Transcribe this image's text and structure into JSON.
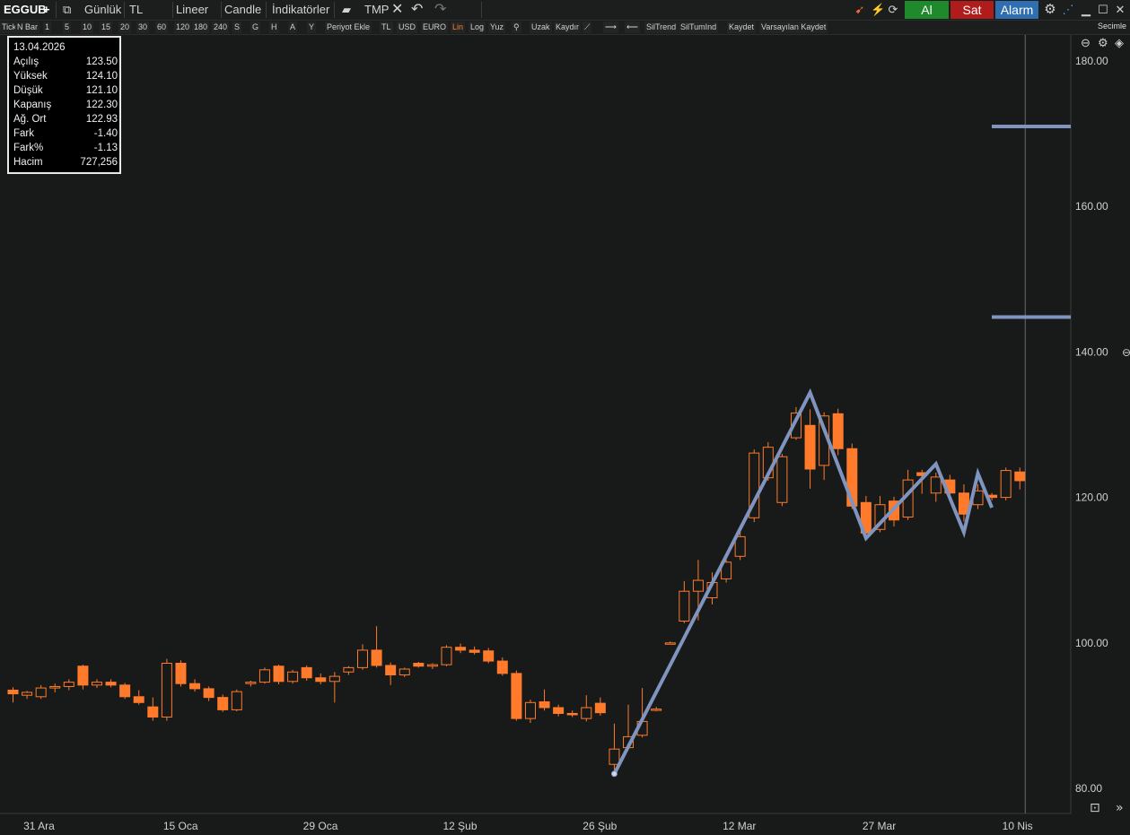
{
  "toolbar": {
    "symbol": "EGGUB",
    "add": "+",
    "period": "Günlük",
    "currency": "TL",
    "scale": "Lineer",
    "style": "Candle",
    "indicators": "İndikatörler",
    "template": "TMP",
    "buy_label": "Al",
    "sell_label": "Sat",
    "alarm_label": "Alarm"
  },
  "toolbar2": {
    "items": [
      "Tick",
      "N Bar",
      "1",
      "5",
      "10",
      "15",
      "20",
      "30",
      "60",
      "120",
      "180",
      "240",
      "S",
      "G",
      "H",
      "A",
      "Y",
      "Periyot Ekle",
      "TL",
      "USD",
      "EURO",
      "Lin",
      "Log",
      "Yuz",
      "Uzak",
      "Kaydır",
      "SilTrend",
      "SilTumInd",
      "Kaydet",
      "Varsayılan Kaydet"
    ],
    "active": "Lin",
    "right_label": "Secimle"
  },
  "info": {
    "date": "13.04.2026",
    "rows": [
      {
        "label": "Açılış",
        "value": "123.50"
      },
      {
        "label": "Yüksek",
        "value": "124.10"
      },
      {
        "label": "Düşük",
        "value": "121.10"
      },
      {
        "label": "Kapanış",
        "value": "122.30"
      },
      {
        "label": "Ağ. Ort",
        "value": "122.93"
      },
      {
        "label": "Fark",
        "value": "-1.40"
      },
      {
        "label": "Fark%",
        "value": "-1.13"
      },
      {
        "label": "Hacim",
        "value": "727,256"
      }
    ]
  },
  "colors": {
    "background": "#181a1a",
    "candle_up": "#ff7a2a",
    "candle_down": "#ff7a2a",
    "trend": "#8094c0",
    "axis_text": "#d0d0d0"
  },
  "chart_data": {
    "type": "candlestick",
    "ylim": [
      78,
      184
    ],
    "yticks": [
      "180.00",
      "160.00",
      "140.00",
      "120.00",
      "100.00",
      "80.00"
    ],
    "ytick_values": [
      180,
      160,
      140,
      120,
      100,
      80
    ],
    "xticks": [
      {
        "label": "31 Ara",
        "index": 1
      },
      {
        "label": "15 Oca",
        "index": 11
      },
      {
        "label": "29 Oca",
        "index": 21
      },
      {
        "label": "12 Şub",
        "index": 31
      },
      {
        "label": "26 Şub",
        "index": 41
      },
      {
        "label": "12 Mar",
        "index": 51
      },
      {
        "label": "27 Mar",
        "index": 61
      },
      {
        "label": "10 Nis",
        "index": 71
      }
    ],
    "candles": [
      {
        "o": 93.5,
        "h": 93.9,
        "l": 91.8,
        "c": 93.0
      },
      {
        "o": 92.8,
        "h": 93.4,
        "l": 92.3,
        "c": 93.2
      },
      {
        "o": 92.6,
        "h": 94.2,
        "l": 92.3,
        "c": 93.8
      },
      {
        "o": 93.8,
        "h": 94.4,
        "l": 93.2,
        "c": 94.0
      },
      {
        "o": 94.0,
        "h": 95.0,
        "l": 93.5,
        "c": 94.6
      },
      {
        "o": 96.8,
        "h": 97.0,
        "l": 93.6,
        "c": 94.2
      },
      {
        "o": 94.2,
        "h": 95.0,
        "l": 93.8,
        "c": 94.6
      },
      {
        "o": 94.6,
        "h": 95.0,
        "l": 93.9,
        "c": 94.2
      },
      {
        "o": 94.2,
        "h": 94.5,
        "l": 92.3,
        "c": 92.6
      },
      {
        "o": 92.6,
        "h": 93.5,
        "l": 91.5,
        "c": 91.8
      },
      {
        "o": 91.2,
        "h": 92.5,
        "l": 89.3,
        "c": 89.8
      },
      {
        "o": 89.8,
        "h": 97.8,
        "l": 89.3,
        "c": 97.2
      },
      {
        "o": 97.2,
        "h": 97.6,
        "l": 94.0,
        "c": 94.4
      },
      {
        "o": 94.4,
        "h": 95.0,
        "l": 93.3,
        "c": 93.7
      },
      {
        "o": 93.7,
        "h": 94.0,
        "l": 92.0,
        "c": 92.5
      },
      {
        "o": 92.5,
        "h": 92.9,
        "l": 90.5,
        "c": 90.8
      },
      {
        "o": 90.8,
        "h": 93.6,
        "l": 90.6,
        "c": 93.3
      },
      {
        "o": 94.4,
        "h": 94.8,
        "l": 94.0,
        "c": 94.6
      },
      {
        "o": 94.6,
        "h": 96.6,
        "l": 94.4,
        "c": 96.3
      },
      {
        "o": 96.8,
        "h": 97.0,
        "l": 94.3,
        "c": 94.7
      },
      {
        "o": 94.7,
        "h": 96.3,
        "l": 94.4,
        "c": 96.0
      },
      {
        "o": 96.6,
        "h": 96.9,
        "l": 94.8,
        "c": 95.2
      },
      {
        "o": 95.2,
        "h": 95.8,
        "l": 94.3,
        "c": 94.7
      },
      {
        "o": 94.7,
        "h": 96.0,
        "l": 91.8,
        "c": 95.4
      },
      {
        "o": 96.0,
        "h": 96.8,
        "l": 95.6,
        "c": 96.6
      },
      {
        "o": 96.6,
        "h": 99.8,
        "l": 96.3,
        "c": 99.0
      },
      {
        "o": 99.0,
        "h": 102.3,
        "l": 96.6,
        "c": 96.9
      },
      {
        "o": 96.9,
        "h": 97.3,
        "l": 94.2,
        "c": 95.6
      },
      {
        "o": 95.6,
        "h": 96.6,
        "l": 95.3,
        "c": 96.4
      },
      {
        "o": 97.2,
        "h": 97.4,
        "l": 96.6,
        "c": 96.8
      },
      {
        "o": 96.8,
        "h": 97.2,
        "l": 96.4,
        "c": 97.0
      },
      {
        "o": 97.0,
        "h": 99.7,
        "l": 96.8,
        "c": 99.4
      },
      {
        "o": 99.4,
        "h": 99.9,
        "l": 98.6,
        "c": 99.0
      },
      {
        "o": 99.0,
        "h": 99.5,
        "l": 98.4,
        "c": 98.7
      },
      {
        "o": 98.9,
        "h": 99.3,
        "l": 97.2,
        "c": 97.5
      },
      {
        "o": 97.5,
        "h": 98.0,
        "l": 95.5,
        "c": 95.8
      },
      {
        "o": 95.8,
        "h": 96.2,
        "l": 89.3,
        "c": 89.6
      },
      {
        "o": 89.6,
        "h": 92.2,
        "l": 89.0,
        "c": 91.8
      },
      {
        "o": 91.9,
        "h": 93.6,
        "l": 90.7,
        "c": 91.1
      },
      {
        "o": 91.1,
        "h": 91.5,
        "l": 89.9,
        "c": 90.3
      },
      {
        "o": 90.3,
        "h": 90.7,
        "l": 89.8,
        "c": 90.2
      },
      {
        "o": 89.6,
        "h": 92.8,
        "l": 89.2,
        "c": 91.1
      },
      {
        "o": 91.7,
        "h": 92.5,
        "l": 90.0,
        "c": 90.4
      },
      {
        "o": 83.3,
        "h": 88.9,
        "l": 82.5,
        "c": 85.4
      },
      {
        "o": 85.6,
        "h": 91.5,
        "l": 85.3,
        "c": 87.1
      },
      {
        "o": 87.3,
        "h": 93.8,
        "l": 87.0,
        "c": 89.2
      },
      {
        "o": 90.9,
        "h": 91.2,
        "l": 90.6,
        "c": 90.9
      },
      {
        "o": 100.0,
        "h": 100.2,
        "l": 99.8,
        "c": 100.0
      },
      {
        "o": 103.0,
        "h": 108.5,
        "l": 102.7,
        "c": 107.1
      },
      {
        "o": 107.1,
        "h": 111.4,
        "l": 103.1,
        "c": 108.6
      },
      {
        "o": 106.2,
        "h": 109.7,
        "l": 105.3,
        "c": 108.3
      },
      {
        "o": 108.8,
        "h": 112.1,
        "l": 108.3,
        "c": 111.1
      },
      {
        "o": 111.9,
        "h": 115.6,
        "l": 111.4,
        "c": 114.6
      },
      {
        "o": 117.2,
        "h": 126.6,
        "l": 116.6,
        "c": 126.1
      },
      {
        "o": 122.7,
        "h": 127.6,
        "l": 122.3,
        "c": 126.9
      },
      {
        "o": 119.3,
        "h": 126.0,
        "l": 118.8,
        "c": 125.6
      },
      {
        "o": 128.2,
        "h": 132.4,
        "l": 127.9,
        "c": 131.6
      },
      {
        "o": 129.9,
        "h": 132.1,
        "l": 121.2,
        "c": 123.9
      },
      {
        "o": 124.4,
        "h": 131.7,
        "l": 122.4,
        "c": 131.2
      },
      {
        "o": 131.5,
        "h": 132.2,
        "l": 125.8,
        "c": 126.7
      },
      {
        "o": 126.7,
        "h": 127.4,
        "l": 118.4,
        "c": 118.8
      },
      {
        "o": 119.3,
        "h": 120.2,
        "l": 114.7,
        "c": 115.1
      },
      {
        "o": 115.6,
        "h": 120.2,
        "l": 115.2,
        "c": 119.0
      },
      {
        "o": 119.5,
        "h": 120.1,
        "l": 116.0,
        "c": 116.9
      },
      {
        "o": 117.3,
        "h": 123.8,
        "l": 116.9,
        "c": 122.4
      },
      {
        "o": 123.4,
        "h": 123.8,
        "l": 120.5,
        "c": 123.0
      },
      {
        "o": 120.6,
        "h": 123.4,
        "l": 119.4,
        "c": 122.8
      },
      {
        "o": 122.4,
        "h": 123.1,
        "l": 120.2,
        "c": 120.6
      },
      {
        "o": 120.6,
        "h": 121.8,
        "l": 116.7,
        "c": 117.7
      },
      {
        "o": 119.0,
        "h": 121.8,
        "l": 118.4,
        "c": 120.9
      },
      {
        "o": 120.3,
        "h": 120.6,
        "l": 119.6,
        "c": 120.0
      },
      {
        "o": 120.0,
        "h": 124.1,
        "l": 119.6,
        "c": 123.7
      },
      {
        "o": 123.5,
        "h": 124.1,
        "l": 121.1,
        "c": 122.3
      }
    ],
    "zigzag": [
      {
        "index": 43,
        "value": 82.0
      },
      {
        "index": 57,
        "value": 134.4
      },
      {
        "index": 61,
        "value": 114.4
      },
      {
        "index": 66,
        "value": 124.6
      },
      {
        "index": 68,
        "value": 115.2
      },
      {
        "index": 69,
        "value": 123.3
      },
      {
        "index": 70,
        "value": 118.6
      }
    ],
    "hlines": [
      {
        "value": 171.0
      },
      {
        "value": 144.8
      }
    ],
    "vline_index": 72
  }
}
